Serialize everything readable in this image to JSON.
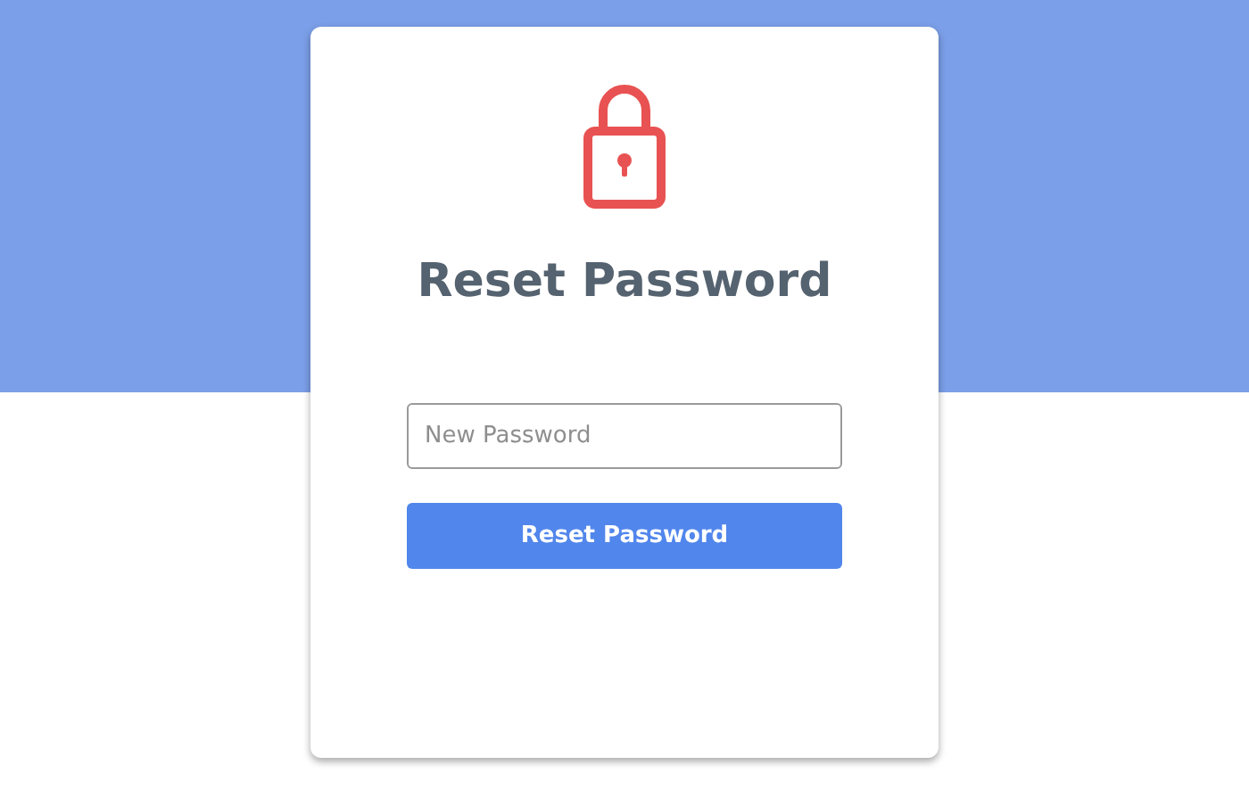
{
  "card": {
    "title": "Reset Password",
    "password_field": {
      "placeholder": "New Password"
    },
    "submit_button": {
      "label": "Reset Password"
    }
  }
}
